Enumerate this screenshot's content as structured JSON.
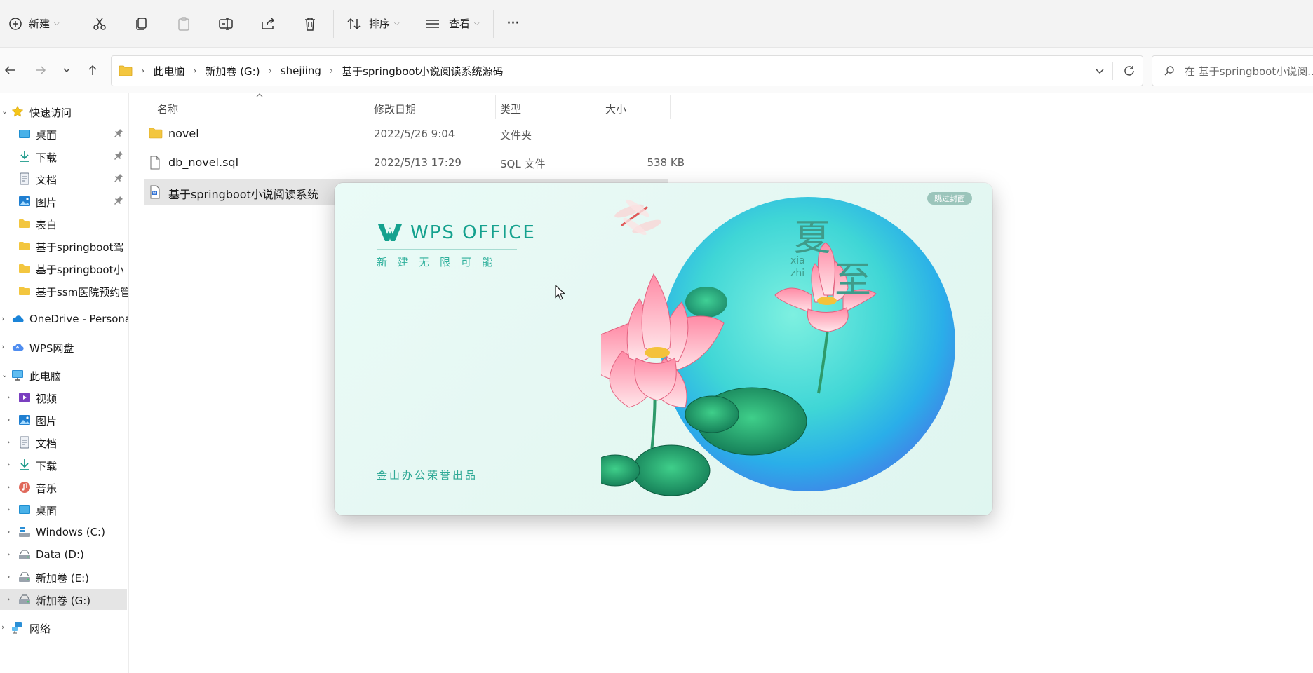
{
  "toolbar": {
    "new_label": "新建",
    "sort_label": "排序",
    "view_label": "查看",
    "more_label": "···"
  },
  "address": {
    "crumbs": [
      "此电脑",
      "新加卷 (G:)",
      "shejiing",
      "基于springboot小说阅读系统源码"
    ],
    "search_placeholder": "在 基于springboot小说阅..."
  },
  "sidebar": {
    "quick_access": "快速访问",
    "quick_items": [
      "桌面",
      "下载",
      "文档",
      "图片",
      "表白",
      "基于springboot驾",
      "基于springboot小",
      "基于ssm医院预约管"
    ],
    "onedrive": "OneDrive - Persona",
    "wps_drive": "WPS网盘",
    "this_pc": "此电脑",
    "pc_items": [
      "视频",
      "图片",
      "文档",
      "下载",
      "音乐",
      "桌面",
      "Windows (C:)",
      "Data (D:)",
      "新加卷 (E:)",
      "新加卷 (G:)"
    ],
    "network": "网络"
  },
  "columns": {
    "name": "名称",
    "modified": "修改日期",
    "type": "类型",
    "size": "大小"
  },
  "files": [
    {
      "name": "novel",
      "date": "2022/5/26 9:04",
      "type": "文件夹",
      "size": ""
    },
    {
      "name": "db_novel.sql",
      "date": "2022/5/13 17:29",
      "type": "SQL 文件",
      "size": "538 KB"
    },
    {
      "name": "基于springboot小说阅读系统",
      "date": "",
      "type": "",
      "size": ""
    }
  ],
  "splash": {
    "skip": "跳过封面",
    "brand": "WPS OFFICE",
    "slogan": "新建无限可能",
    "publisher": "金山办公荣誉出品",
    "season_char1": "夏",
    "season_char2": "至",
    "pinyin1": "xia",
    "pinyin2": "zhi"
  },
  "colors": {
    "wps_teal": "#15a18e",
    "selection": "#e5e5e5",
    "folder_yellow": "#f3c63f",
    "onedrive_blue": "#1b84d8"
  }
}
